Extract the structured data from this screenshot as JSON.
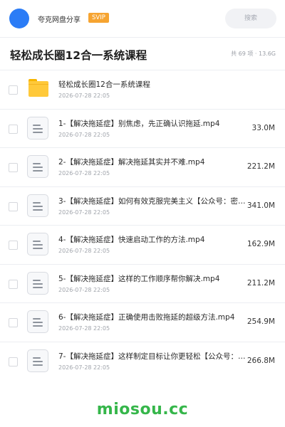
{
  "header": {
    "username": "夸克网盘分享",
    "badge": "SVIP",
    "search_placeholder": "搜索",
    "accent_color": "#2b7cf6"
  },
  "title": {
    "text": "轻松成长圈12合一系统课程",
    "summary": "共 69 项 · 13.6G"
  },
  "items": [
    {
      "type": "folder",
      "name": "轻松成长圈12合一系统课程",
      "date": "2026-07-28 22:05",
      "size": ""
    },
    {
      "type": "file",
      "name": "1-【解决拖延症】别焦虑，先正确认识拖延.mp4",
      "date": "2026-07-28 22:05",
      "size": "33.0M"
    },
    {
      "type": "file",
      "name": "2-【解决拖延症】解决拖延其实并不难.mp4",
      "date": "2026-07-28 22:05",
      "size": "221.2M"
    },
    {
      "type": "file",
      "name": "3-【解决拖延症】如何有效克服完美主义【公众号：密…",
      "date": "2026-07-28 22:05",
      "size": "341.0M"
    },
    {
      "type": "file",
      "name": "4-【解决拖延症】快速启动工作的方法.mp4",
      "date": "2026-07-28 22:05",
      "size": "162.9M"
    },
    {
      "type": "file",
      "name": "5-【解决拖延症】这样的工作顺序帮你解决.mp4",
      "date": "2026-07-28 22:05",
      "size": "211.2M"
    },
    {
      "type": "file",
      "name": "6-【解决拖延症】正确使用击败拖延的超级方法.mp4",
      "date": "2026-07-28 22:05",
      "size": "254.9M"
    },
    {
      "type": "file",
      "name": "7-【解决拖延症】这样制定目标让你更轻松【公众号：…",
      "date": "2026-07-28 22:05",
      "size": "266.8M"
    }
  ],
  "watermark": "miosou.cc"
}
